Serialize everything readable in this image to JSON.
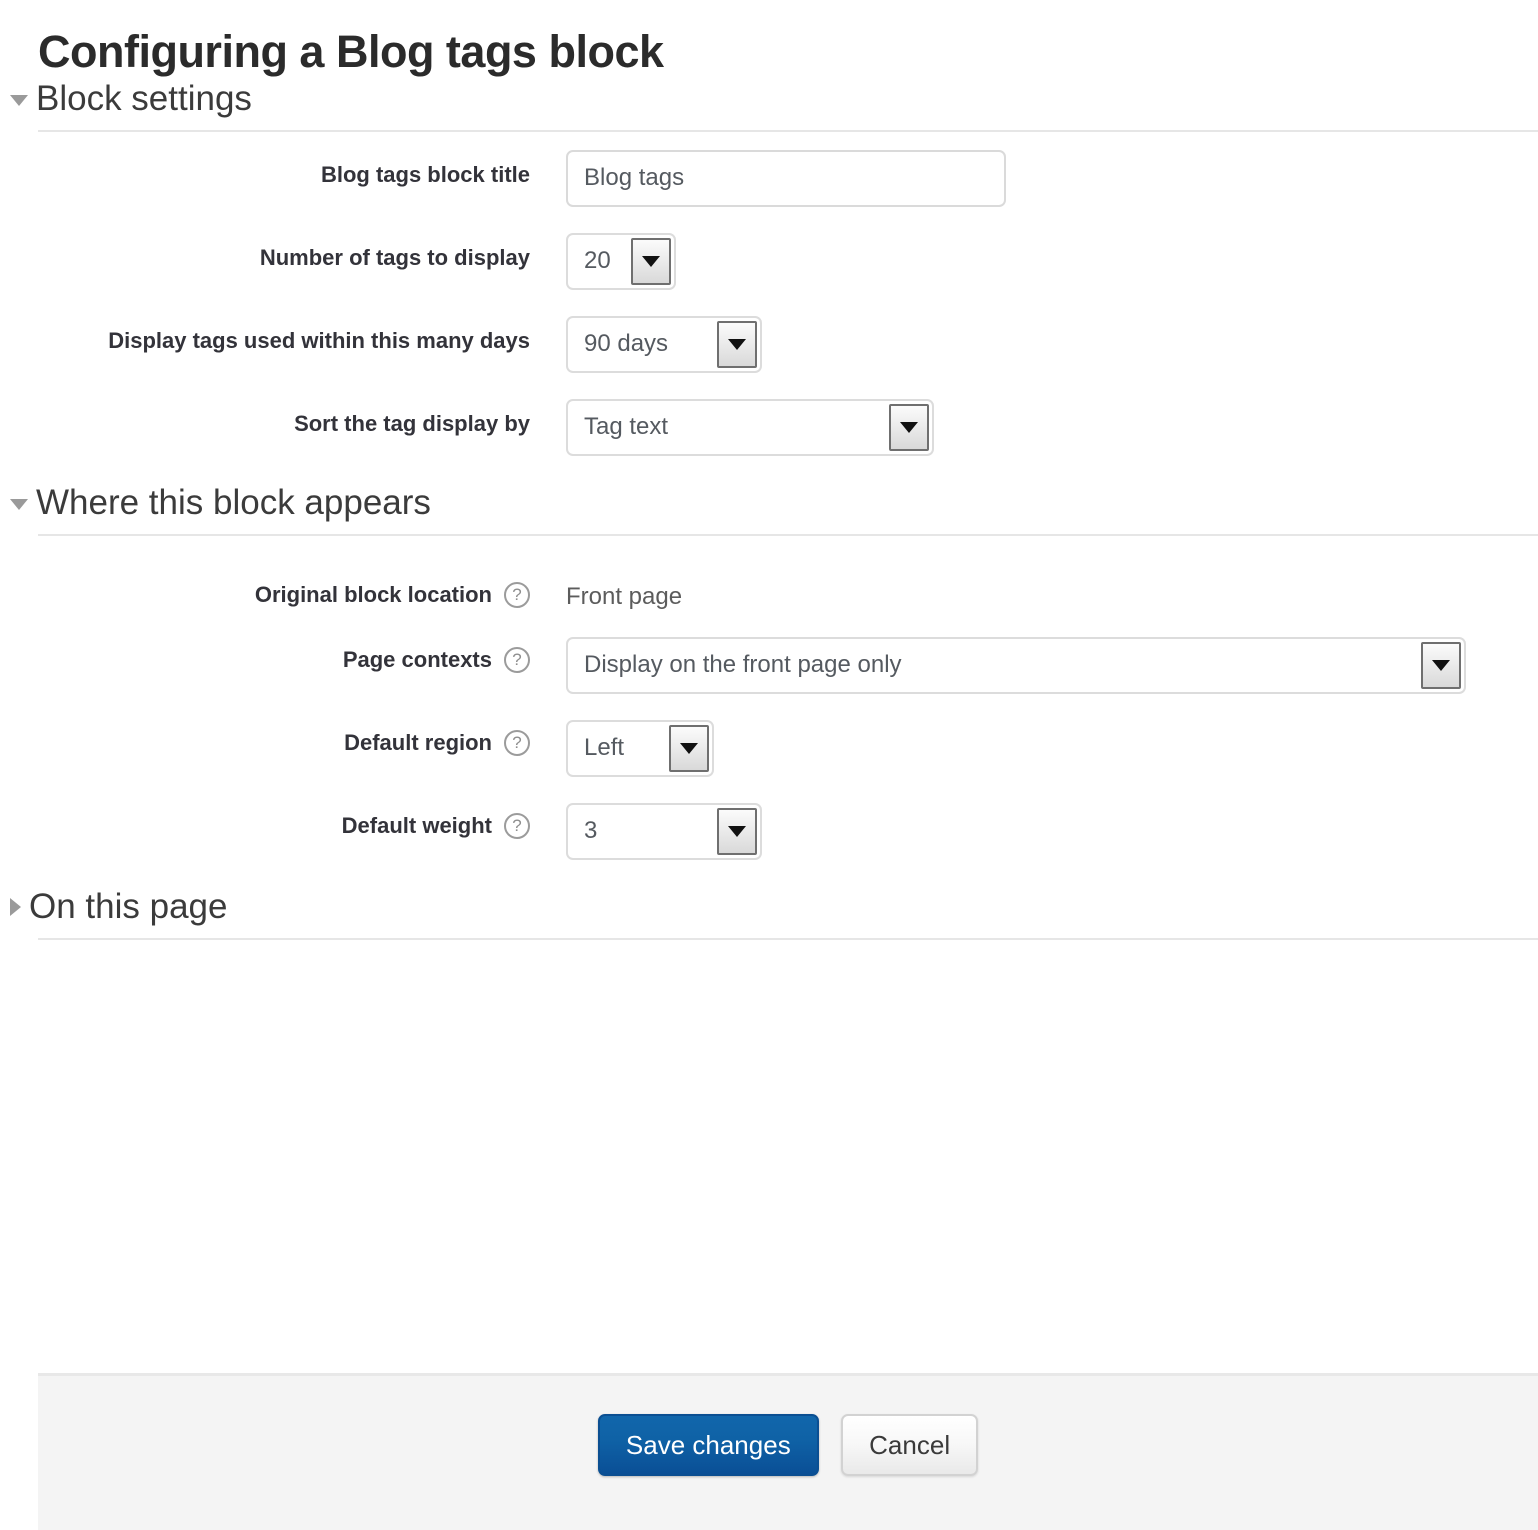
{
  "page": {
    "title": "Configuring a Blog tags block"
  },
  "sections": {
    "block_settings": {
      "title": "Block settings",
      "expanded": true,
      "toggle_icon": "triangle-down-icon",
      "fields": {
        "block_title": {
          "label": "Blog tags block title",
          "value": "Blog tags",
          "placeholder": ""
        },
        "number_of_tags": {
          "label": "Number of tags to display",
          "value": "20",
          "arrow_icon": "triangle-down-icon"
        },
        "days": {
          "label": "Display tags used within this many days",
          "value": "90 days",
          "arrow_icon": "triangle-down-icon"
        },
        "sort_by": {
          "label": "Sort the tag display by",
          "value": "Tag text",
          "arrow_icon": "triangle-down-icon"
        }
      }
    },
    "where_block_appears": {
      "title": "Where this block appears",
      "expanded": true,
      "toggle_icon": "triangle-down-icon",
      "fields": {
        "original_location": {
          "label": "Original block location",
          "help_icon": "help-circle-icon",
          "value": "Front page"
        },
        "page_contexts": {
          "label": "Page contexts",
          "help_icon": "help-circle-icon",
          "value": "Display on the front page only",
          "arrow_icon": "triangle-down-icon"
        },
        "default_region": {
          "label": "Default region",
          "help_icon": "help-circle-icon",
          "value": "Left",
          "arrow_icon": "triangle-down-icon"
        },
        "default_weight": {
          "label": "Default weight",
          "help_icon": "help-circle-icon",
          "value": "3",
          "arrow_icon": "triangle-down-icon"
        }
      }
    },
    "on_this_page": {
      "title": "On this page",
      "expanded": false,
      "toggle_icon": "triangle-right-icon"
    }
  },
  "footer": {
    "save_label": "Save changes",
    "cancel_label": "Cancel",
    "primary_color": "#0f62a6"
  }
}
